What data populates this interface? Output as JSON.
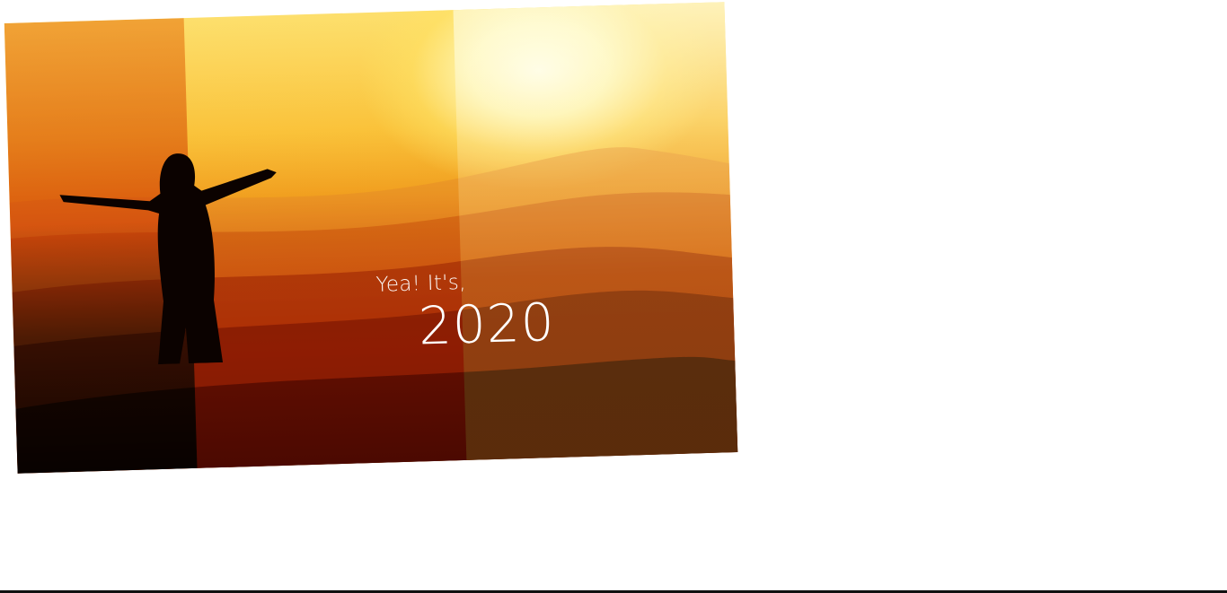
{
  "greeting": {
    "line1": "Yea! It's,",
    "line2": "2020"
  },
  "colors": {
    "sky_top": "#fde277",
    "sun": "#fffdee",
    "ground": "#3b0d02",
    "text": "#ffffff",
    "bottom_rule": "#111111"
  }
}
